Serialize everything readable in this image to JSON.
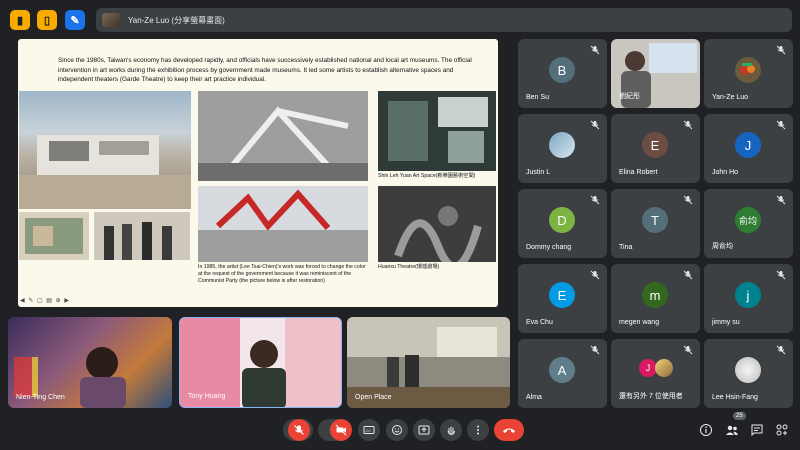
{
  "presenter_bar": {
    "label": "Yan-Ze Luo (分享螢幕畫面)"
  },
  "slide": {
    "paragraph": "Since the 1980s, Taiwan's economy has developed rapidly, and officials have successively established national and local art museums. The official intervention in art works during the exhibition process by government made museums. It led some artists to establish alternative spaces and independent theaters (Garde Theatre) to keep their art practice individual.",
    "caption_shin": "Shin Leh Yuan Art Space(新樂園藝術空間)",
    "caption_lee": "In 1985, the artist (Lee Tsai-Chien)'s work was forced to change the color at the request of the government because it was reminiscent of the Communist Party (the picture below is after restoration)",
    "caption_huanxu": "Huanxu Theatre(環墟劇場)"
  },
  "participants": [
    {
      "name": "Ben Su",
      "initial": "B",
      "color": "#546e7a"
    },
    {
      "name": "劉紀彤",
      "initial": "",
      "color": ""
    },
    {
      "name": "Yan-Ze Luo",
      "initial": "",
      "color": ""
    },
    {
      "name": "Justin L",
      "initial": "",
      "color": ""
    },
    {
      "name": "Elina Robert",
      "initial": "E",
      "color": "#6d4c41"
    },
    {
      "name": "John Ho",
      "initial": "J",
      "color": "#1565c0"
    },
    {
      "name": "Dommy chang",
      "initial": "D",
      "color": "#7cb342"
    },
    {
      "name": "Tina",
      "initial": "T",
      "color": "#546e7a"
    },
    {
      "name": "周俞均",
      "initial": "俞均",
      "color": "#2e7d32"
    },
    {
      "name": "Eva Chu",
      "initial": "E",
      "color": "#039be5"
    },
    {
      "name": "megen wang",
      "initial": "m",
      "color": "#33691e"
    },
    {
      "name": "jimmy su",
      "initial": "j",
      "color": "#00838f"
    },
    {
      "name": "Alma",
      "initial": "A",
      "color": "#607d8b"
    },
    {
      "name": "還有另外 7 位使用者",
      "initial": "J",
      "color": "#d81b60"
    },
    {
      "name": "Lee Hsin-Fang",
      "initial": "",
      "color": ""
    }
  ],
  "video_tiles": [
    {
      "name": "Nien-Ting Chen"
    },
    {
      "name": "Tony Huang"
    },
    {
      "name": "Open Place"
    }
  ],
  "toolbar": {
    "participant_count": "25"
  },
  "icons": {
    "mic_off": "mic-off-icon",
    "cam_off": "camera-off-icon",
    "cc": "captions-icon",
    "emoji": "emoji-icon",
    "present": "present-icon",
    "hand": "raise-hand-icon",
    "more": "more-icon",
    "hangup": "hang-up-icon",
    "info": "info-icon",
    "people": "people-icon",
    "chat": "chat-icon",
    "activities": "activities-icon"
  },
  "colors": {
    "accent_red": "#ea4335",
    "tile_bg": "#3c4043",
    "page_bg": "#202124"
  }
}
